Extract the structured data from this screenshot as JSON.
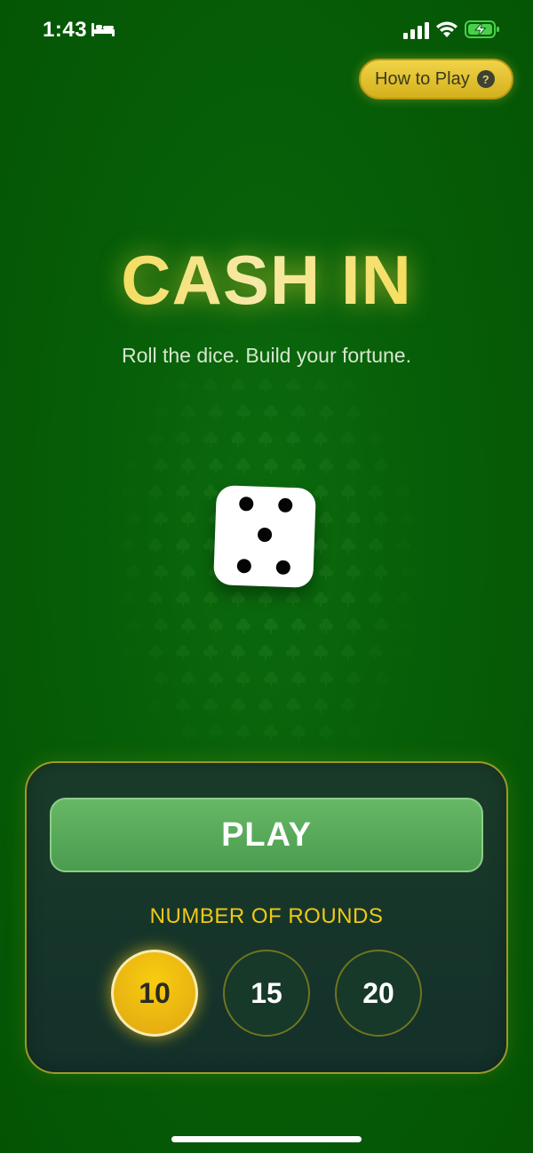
{
  "status_bar": {
    "time": "1:43",
    "icons": [
      "bed-icon",
      "signal-icon",
      "wifi-icon",
      "battery-charging-icon"
    ]
  },
  "header": {
    "help_label": "How to Play",
    "help_icon_glyph": "?"
  },
  "hero": {
    "title": "CASH IN",
    "subtitle": "Roll the dice. Build your fortune."
  },
  "dice": {
    "face_value": 5
  },
  "panel": {
    "play_label": "PLAY",
    "rounds_label": "NUMBER OF ROUNDS",
    "round_options": [
      {
        "label": "10",
        "selected": true
      },
      {
        "label": "15",
        "selected": false
      },
      {
        "label": "20",
        "selected": false
      }
    ]
  },
  "colors": {
    "background_green": "#075f08",
    "accent_gold": "#f0c818",
    "play_green": "#5aac5c",
    "panel_dark": "#17392a"
  }
}
